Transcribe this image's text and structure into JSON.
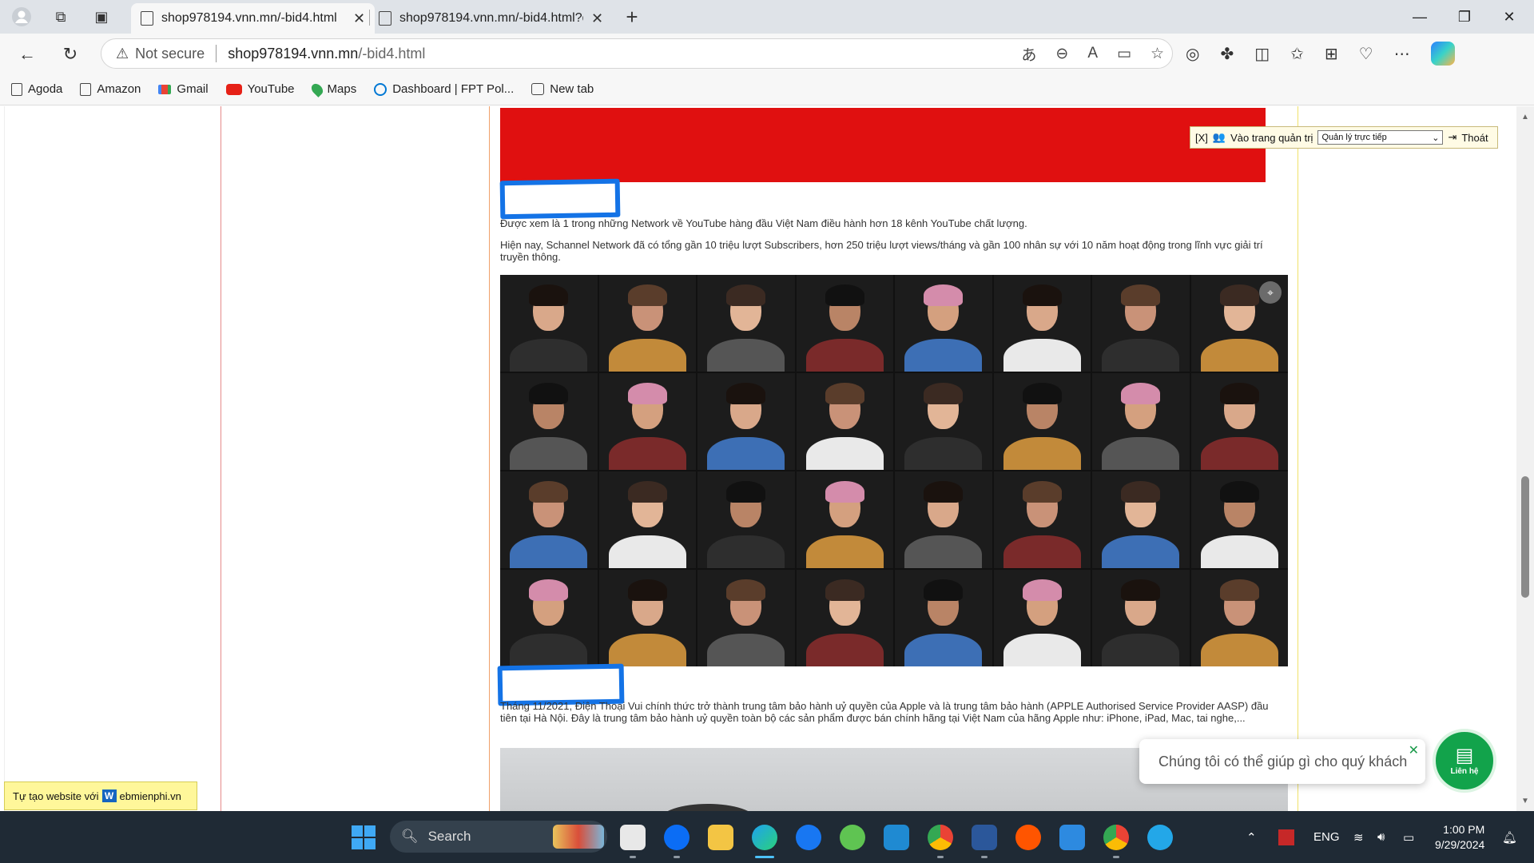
{
  "browser": {
    "tabs": [
      {
        "title": "shop978194.vnn.mn/-bid4.html",
        "active": true
      },
      {
        "title": "shop978194.vnn.mn/-bid4.html?q",
        "active": false
      }
    ],
    "security_label": "Not secure",
    "url_host": "shop978194.vnn.mn",
    "url_path": "/-bid4.html"
  },
  "bookmarks": [
    {
      "label": "Agoda",
      "icon": "page-icon"
    },
    {
      "label": "Amazon",
      "icon": "page-icon"
    },
    {
      "label": "Gmail",
      "icon": "gmail-icon"
    },
    {
      "label": "YouTube",
      "icon": "youtube-icon"
    },
    {
      "label": "Maps",
      "icon": "maps-icon"
    },
    {
      "label": "Dashboard | FPT Pol...",
      "icon": "circle-icon"
    },
    {
      "label": "New tab",
      "icon": "newtab-icon"
    }
  ],
  "page": {
    "para1": "Được xem là 1 trong những Network về YouTube hàng đầu Việt Nam điều hành hơn 18 kênh YouTube chất lượng.",
    "para2": "Hiện nay, Schannel Network đã có tổng gần 10 triệu lượt Subscribers, hơn 250 triệu lượt views/tháng và gần 100 nhân sự với 10 năm hoạt động trong lĩnh vực giải trí truyền thông.",
    "para3": "Tháng 11/2021, Điện Thoại Vui chính thức trở thành trung tâm bảo hành uỷ quyền của Apple và là trung tâm bảo hành (APPLE Authorised Service Provider AASP) đầu tiên tại Hà Nội. Đây là trung tâm bảo hành uỷ quyền toàn bộ các sản phẩm được bán chính hãng tại Việt Nam của hãng Apple như: iPhone, iPad, Mac, tai nghe,..."
  },
  "admin_bar": {
    "close": "[X]",
    "admin_link": "Vào trang quản trị",
    "select_value": "Quản lý trực tiếp",
    "logout": "Thoát"
  },
  "made_with": {
    "prefix": "Tự tạo website với",
    "logo_letter": "W",
    "suffix": "ebmienphi.vn"
  },
  "chat": {
    "bubble": "Chúng tôi có thể giúp gì cho quý khách",
    "close": "✕",
    "button_label": "Liên hệ"
  },
  "taskbar": {
    "search_placeholder": "Search",
    "language": "ENG",
    "time": "1:00 PM",
    "date": "9/29/2024"
  },
  "colors": {
    "accent_red": "#e01010",
    "redaction_blue": "#1473e6",
    "chat_green": "#12a34b",
    "left_column_line": "#e58a8a",
    "right_column_line": "#f0e26a"
  }
}
